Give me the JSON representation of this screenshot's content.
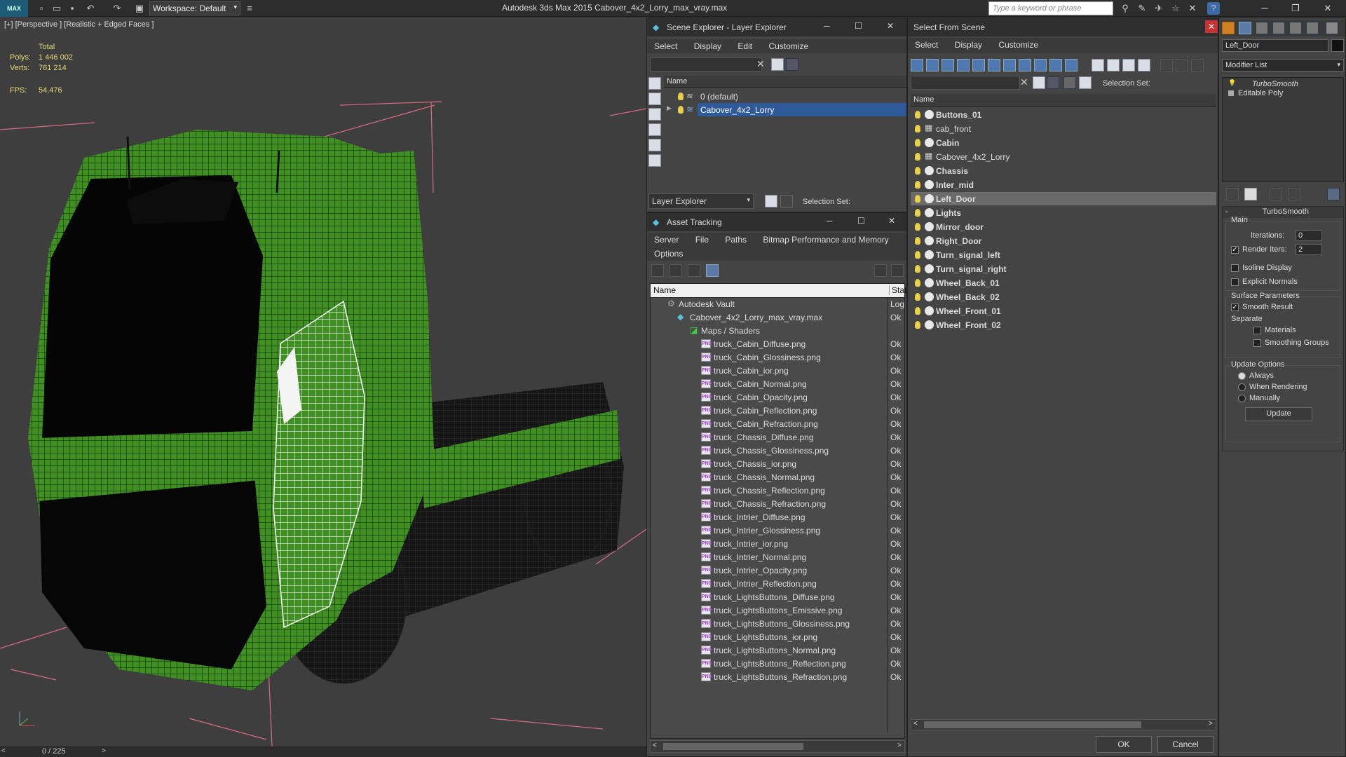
{
  "app": {
    "logo_text": "MAX",
    "title": "Autodesk 3ds Max  2015    Cabover_4x2_Lorry_max_vray.max",
    "workspace": "Workspace: Default",
    "search_placeholder": "Type a keyword or phrase"
  },
  "viewport": {
    "label": "[+] [Perspective ] [Realistic + Edged Faces ]",
    "stats_total": "Total",
    "polys_label": "Polys:",
    "polys_value": "1 446 002",
    "verts_label": "Verts:",
    "verts_value": "761 214",
    "fps_label": "FPS:",
    "fps_value": "54,476",
    "frame_counter": "0 / 225"
  },
  "scene_explorer": {
    "title": "Scene Explorer - Layer Explorer",
    "menu": [
      "Select",
      "Display",
      "Edit",
      "Customize"
    ],
    "column": "Name",
    "layers": [
      {
        "name": "0 (default)",
        "selected": false
      },
      {
        "name": "Cabover_4x2_Lorry",
        "selected": true
      }
    ],
    "footer_dropdown": "Layer Explorer",
    "selection_set": "Selection Set:"
  },
  "asset_tracking": {
    "title": "Asset Tracking",
    "menu": [
      "Server",
      "File",
      "Paths",
      "Bitmap Performance and Memory"
    ],
    "menu2": "Options",
    "col_name": "Name",
    "col_status": "Statu",
    "vault": "Autodesk Vault",
    "vault_status": "Log",
    "file": "Cabover_4x2_Lorry_max_vray.max",
    "file_status": "Ok",
    "maps": "Maps / Shaders",
    "files": [
      "truck_Cabin_Diffuse.png",
      "truck_Cabin_Glossiness.png",
      "truck_Cabin_ior.png",
      "truck_Cabin_Normal.png",
      "truck_Cabin_Opacity.png",
      "truck_Cabin_Reflection.png",
      "truck_Cabin_Refraction.png",
      "truck_Chassis_Diffuse.png",
      "truck_Chassis_Glossiness.png",
      "truck_Chassis_ior.png",
      "truck_Chassis_Normal.png",
      "truck_Chassis_Reflection.png",
      "truck_Chassis_Refraction.png",
      "truck_Intrier_Diffuse.png",
      "truck_Intrier_Glossiness.png",
      "truck_Intrier_ior.png",
      "truck_Intrier_Normal.png",
      "truck_Intrier_Opacity.png",
      "truck_Intrier_Reflection.png",
      "truck_LightsButtons_Diffuse.png",
      "truck_LightsButtons_Emissive.png",
      "truck_LightsButtons_Glossiness.png",
      "truck_LightsButtons_ior.png",
      "truck_LightsButtons_Normal.png",
      "truck_LightsButtons_Reflection.png",
      "truck_LightsButtons_Refraction.png"
    ],
    "ok": "Ok"
  },
  "select_from_scene": {
    "title": "Select From Scene",
    "menu": [
      "Select",
      "Display",
      "Customize"
    ],
    "selection_set": "Selection Set:",
    "column": "Name",
    "objects": [
      {
        "name": "Buttons_01",
        "bold": true
      },
      {
        "name": "cab_front",
        "bold": false
      },
      {
        "name": "Cabin",
        "bold": true
      },
      {
        "name": "Cabover_4x2_Lorry",
        "bold": false
      },
      {
        "name": "Chassis",
        "bold": true
      },
      {
        "name": "Inter_mid",
        "bold": true
      },
      {
        "name": "Left_Door",
        "bold": true,
        "highlight": true
      },
      {
        "name": "Lights",
        "bold": true
      },
      {
        "name": "Mirror_door",
        "bold": true
      },
      {
        "name": "Right_Door",
        "bold": true
      },
      {
        "name": "Turn_signal_left",
        "bold": true
      },
      {
        "name": "Turn_signal_right",
        "bold": true
      },
      {
        "name": "Wheel_Back_01",
        "bold": true
      },
      {
        "name": "Wheel_Back_02",
        "bold": true
      },
      {
        "name": "Wheel_Front_01",
        "bold": true
      },
      {
        "name": "Wheel_Front_02",
        "bold": true
      }
    ],
    "ok": "OK",
    "cancel": "Cancel"
  },
  "command_panel": {
    "object_name": "Left_Door",
    "modifier_list": "Modifier List",
    "stack": [
      "TurboSmooth",
      "Editable Poly"
    ],
    "rollout": "TurboSmooth",
    "main": "Main",
    "iterations_label": "Iterations:",
    "iterations": "0",
    "render_iters_label": "Render Iters:",
    "render_iters": "2",
    "isoline": "Isoline Display",
    "explicit": "Explicit Normals",
    "surface": "Surface Parameters",
    "smooth_result": "Smooth Result",
    "separate": "Separate",
    "materials": "Materials",
    "smoothing_groups": "Smoothing Groups",
    "update_options": "Update Options",
    "always": "Always",
    "when_rendering": "When Rendering",
    "manually": "Manually",
    "update": "Update"
  }
}
